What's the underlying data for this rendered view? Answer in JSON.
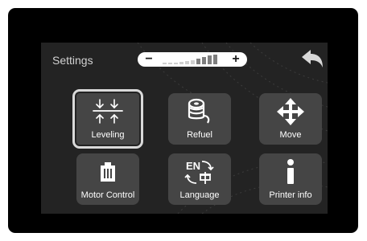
{
  "header": {
    "title": "Settings",
    "volume": {
      "minus_label": "−",
      "plus_label": "+",
      "level_fraction": 0.6
    },
    "back_icon": "back-arrow-icon"
  },
  "menu": {
    "selected": "Leveling",
    "items": [
      {
        "label": "Leveling",
        "icon": "leveling-icon"
      },
      {
        "label": "Refuel",
        "icon": "filament-spool-icon"
      },
      {
        "label": "Move",
        "icon": "move-arrows-icon"
      },
      {
        "label": "Motor Control",
        "icon": "motor-icon"
      },
      {
        "label": "Language",
        "icon": "language-icon"
      },
      {
        "label": "Printer info",
        "icon": "info-icon"
      }
    ]
  },
  "colors": {
    "screen_bg": "#232323",
    "tile_bg": "#454545",
    "selection_outline": "#d9d9d9",
    "text": "#ffffff"
  }
}
